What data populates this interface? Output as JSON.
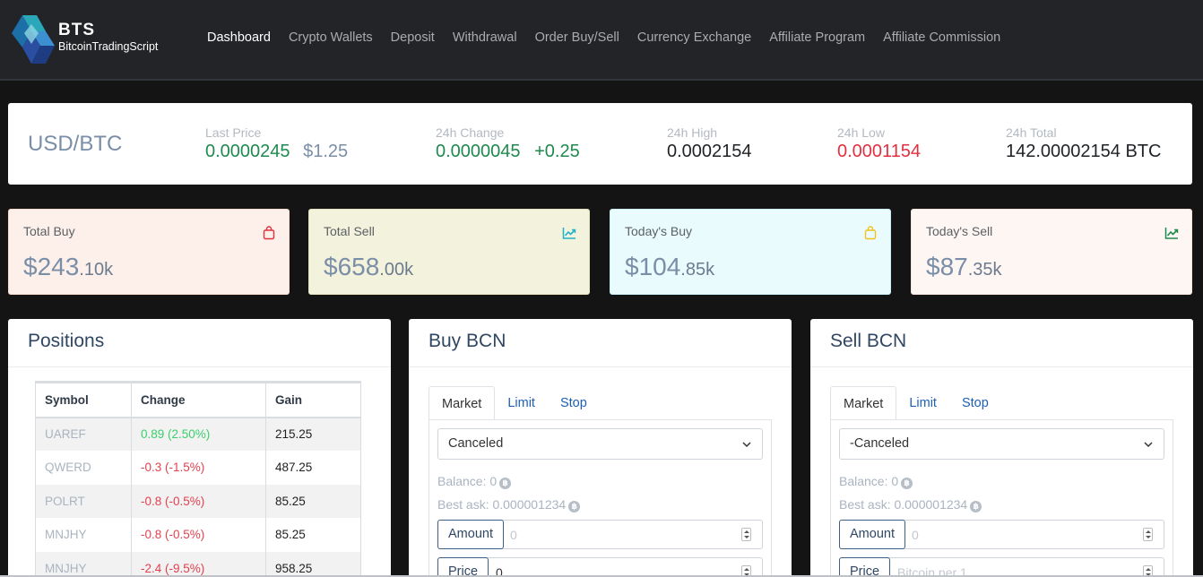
{
  "brand": {
    "name": "BTS",
    "subtitle": "BitcoinTradingScript"
  },
  "nav": [
    {
      "label": "Dashboard",
      "active": true
    },
    {
      "label": "Crypto Wallets"
    },
    {
      "label": "Deposit"
    },
    {
      "label": "Withdrawal"
    },
    {
      "label": "Order Buy/Sell"
    },
    {
      "label": "Currency Exchange"
    },
    {
      "label": "Affiliate Program"
    },
    {
      "label": "Affiliate Commission"
    }
  ],
  "ticker": {
    "pair": "USD/BTC",
    "last_price": {
      "label": "Last Price",
      "value": "0.0000245",
      "usd": "$1.25"
    },
    "change": {
      "label": "24h Change",
      "value": "0.0000045",
      "delta": "+0.25"
    },
    "high": {
      "label": "24h High",
      "value": "0.0002154"
    },
    "low": {
      "label": "24h Low",
      "value": "0.0001154"
    },
    "total": {
      "label": "24h Total",
      "value": "142.00002154 BTC"
    }
  },
  "cards": [
    {
      "label": "Total Buy",
      "big": "$243",
      "small": ".10k",
      "bg": "#fdf0ea",
      "icon": "bag-icon",
      "icon_color": "#e2303f"
    },
    {
      "label": "Total Sell",
      "big": "$658",
      "small": ".00k",
      "bg": "#f3f2dc",
      "icon": "trend-up-icon",
      "icon_color": "#1fb3c9"
    },
    {
      "label": "Today's Buy",
      "big": "$104",
      "small": ".85k",
      "bg": "#e9fbfd",
      "icon": "bag-icon",
      "icon_color": "#f2c21a"
    },
    {
      "label": "Today's Sell",
      "big": "$87",
      "small": ".35k",
      "bg": "#fdf6f3",
      "icon": "trend-up-icon",
      "icon_color": "#1e8a4e"
    }
  ],
  "positions": {
    "title": "Positions",
    "headers": [
      "Symbol",
      "Change",
      "Gain"
    ],
    "rows": [
      {
        "symbol": "UAREF",
        "change": "0.89 (2.50%)",
        "gain": "215.25",
        "dir": "pos"
      },
      {
        "symbol": "QWERD",
        "change": "-0.3 (-1.5%)",
        "gain": "487.25",
        "dir": "neg"
      },
      {
        "symbol": "POLRT",
        "change": "-0.8 (-0.5%)",
        "gain": "85.25",
        "dir": "neg"
      },
      {
        "symbol": "MNJHY",
        "change": "-0.8 (-0.5%)",
        "gain": "85.25",
        "dir": "neg"
      },
      {
        "symbol": "MNJHY",
        "change": "-2.4 (-9.5%)",
        "gain": "958.25",
        "dir": "neg"
      }
    ]
  },
  "buy": {
    "title": "Buy BCN",
    "tabs": [
      "Market",
      "Limit",
      "Stop"
    ],
    "select_value": "Canceled",
    "balance": "Balance: 0",
    "best_ask": "Best ask: 0.000001234",
    "amount_label": "Amount",
    "amount_placeholder": "0",
    "price_label": "Price",
    "price_value": "0",
    "price_placeholder": ""
  },
  "sell": {
    "title": "Sell BCN",
    "tabs": [
      "Market",
      "Limit",
      "Stop"
    ],
    "select_value": "-Canceled",
    "balance": "Balance: 0",
    "best_ask": "Best ask: 0.000001234",
    "amount_label": "Amount",
    "amount_placeholder": "0",
    "price_label": "Price",
    "price_value": "",
    "price_placeholder": "Bitcoin per 1"
  }
}
